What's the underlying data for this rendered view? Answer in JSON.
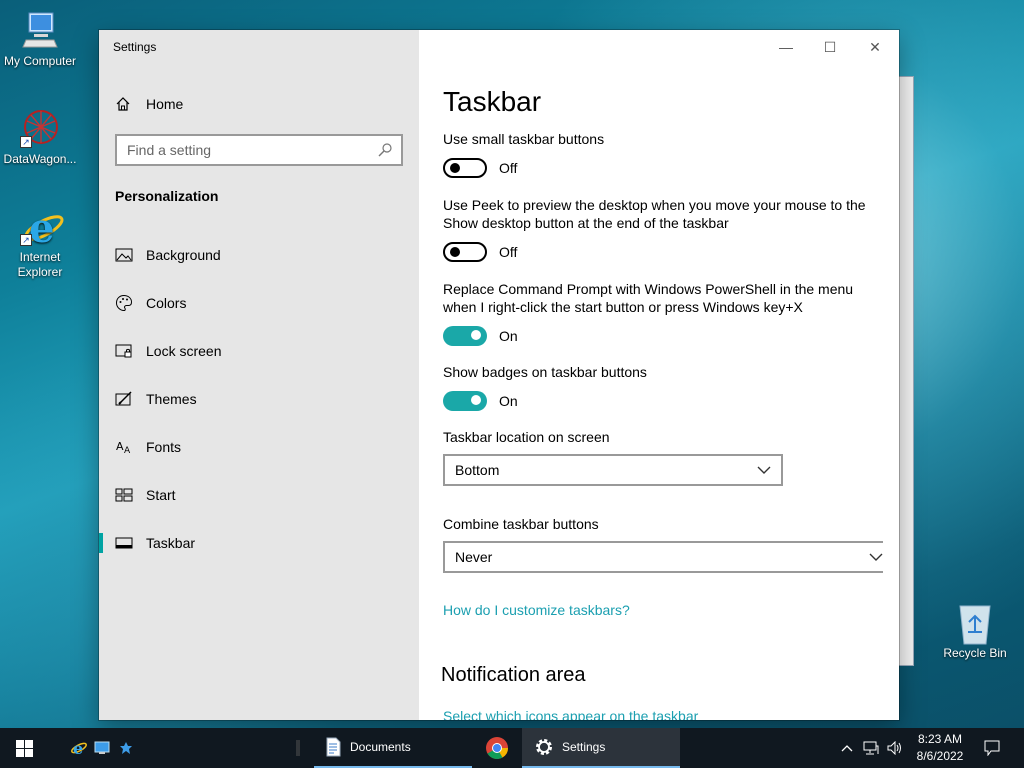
{
  "desktop": {
    "icons": [
      {
        "label": "My Computer",
        "icon": "computer-icon"
      },
      {
        "label": "DataWagon...",
        "icon": "datawagon-icon"
      },
      {
        "label": "Internet Explorer",
        "icon": "internet-explorer-icon"
      },
      {
        "label": "Recycle Bin",
        "icon": "recycle-bin-icon"
      }
    ]
  },
  "window": {
    "title": "Settings",
    "controls": {
      "minimize": "—",
      "maximize": "☐",
      "close": "✕"
    }
  },
  "sidebar": {
    "home_label": "Home",
    "search_placeholder": "Find a setting",
    "section_title": "Personalization",
    "items": [
      {
        "label": "Background",
        "icon": "image-icon"
      },
      {
        "label": "Colors",
        "icon": "palette-icon"
      },
      {
        "label": "Lock screen",
        "icon": "lock-screen-icon"
      },
      {
        "label": "Themes",
        "icon": "themes-icon"
      },
      {
        "label": "Fonts",
        "icon": "fonts-icon"
      },
      {
        "label": "Start",
        "icon": "start-icon"
      },
      {
        "label": "Taskbar",
        "icon": "taskbar-icon",
        "selected": true
      }
    ]
  },
  "main": {
    "title": "Taskbar",
    "settings": [
      {
        "label": "Use small taskbar buttons",
        "state": "Off"
      },
      {
        "label": "Use Peek to preview the desktop when you move your mouse to the Show desktop button at the end of the taskbar",
        "state": "Off"
      },
      {
        "label": "Replace Command Prompt with Windows PowerShell in the menu when I right-click the start button or press Windows key+X",
        "state": "On"
      },
      {
        "label": "Show badges on taskbar buttons",
        "state": "On"
      }
    ],
    "location": {
      "label": "Taskbar location on screen",
      "value": "Bottom"
    },
    "combine": {
      "label": "Combine taskbar buttons",
      "value": "Never"
    },
    "help_link": "How do I customize taskbars?",
    "notification_title": "Notification area",
    "notification_link": "Select which icons appear on the taskbar"
  },
  "taskbar": {
    "quick_launch": [
      "internet-explorer-icon",
      "desktop-icon",
      "pin-icon"
    ],
    "apps": [
      {
        "label": "Documents",
        "icon": "documents-icon"
      },
      {
        "label": "",
        "icon": "chrome-icon"
      },
      {
        "label": "Settings",
        "icon": "gear-icon"
      }
    ],
    "clock": {
      "time": "8:23 AM",
      "date": "8/6/2022"
    }
  },
  "colors": {
    "accent": "#1aa8a8",
    "link": "#1b9fb0",
    "taskbar": "#101820"
  }
}
